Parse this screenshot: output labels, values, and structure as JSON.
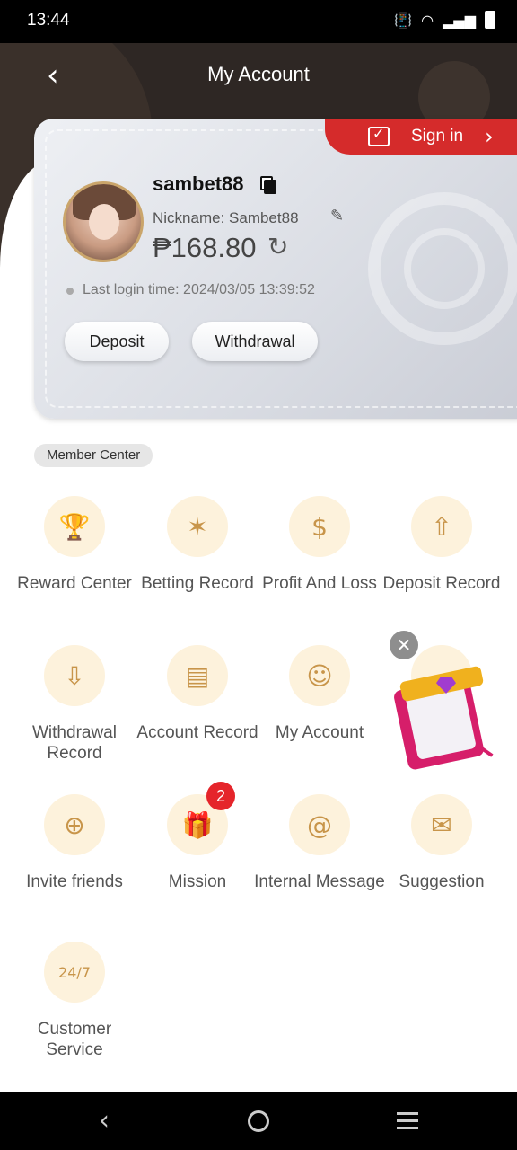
{
  "status_bar": {
    "time": "13:44"
  },
  "header": {
    "title": "My Account"
  },
  "signin": {
    "label": "Sign in"
  },
  "profile": {
    "username": "sambet88",
    "nickname": "Nickname: Sambet88",
    "balance": "₱168.80",
    "last_login": "Last login time: 2024/03/05 13:39:52"
  },
  "actions": {
    "deposit": "Deposit",
    "withdrawal": "Withdrawal"
  },
  "section": {
    "label": "Member Center"
  },
  "grid": [
    {
      "label": "Reward Center",
      "icon": "trophy-icon"
    },
    {
      "label": "Betting Record",
      "icon": "star-burst-icon"
    },
    {
      "label": "Profit And Loss",
      "icon": "receipt-dollar-icon"
    },
    {
      "label": "Deposit Record",
      "icon": "clipboard-upload-icon"
    },
    {
      "label": "Withdrawal Record",
      "icon": "clipboard-download-icon"
    },
    {
      "label": "Account Record",
      "icon": "statement-icon"
    },
    {
      "label": "My Account",
      "icon": "user-icon"
    },
    {
      "label": "Invite friends",
      "icon": "add-user-icon"
    },
    {
      "label": "Mission",
      "icon": "gift-icon"
    },
    {
      "label": "Internal Message",
      "icon": "at-icon"
    },
    {
      "label": "Suggestion",
      "icon": "chat-star-icon"
    },
    {
      "label": "Customer Service",
      "icon": "support-24-7-icon"
    }
  ],
  "mission_badge": "2",
  "colors": {
    "accent": "#d52b2b",
    "icon_gold": "#c8954a",
    "icon_bg": "#fdf2dc",
    "header_bg": "#2e2724"
  }
}
